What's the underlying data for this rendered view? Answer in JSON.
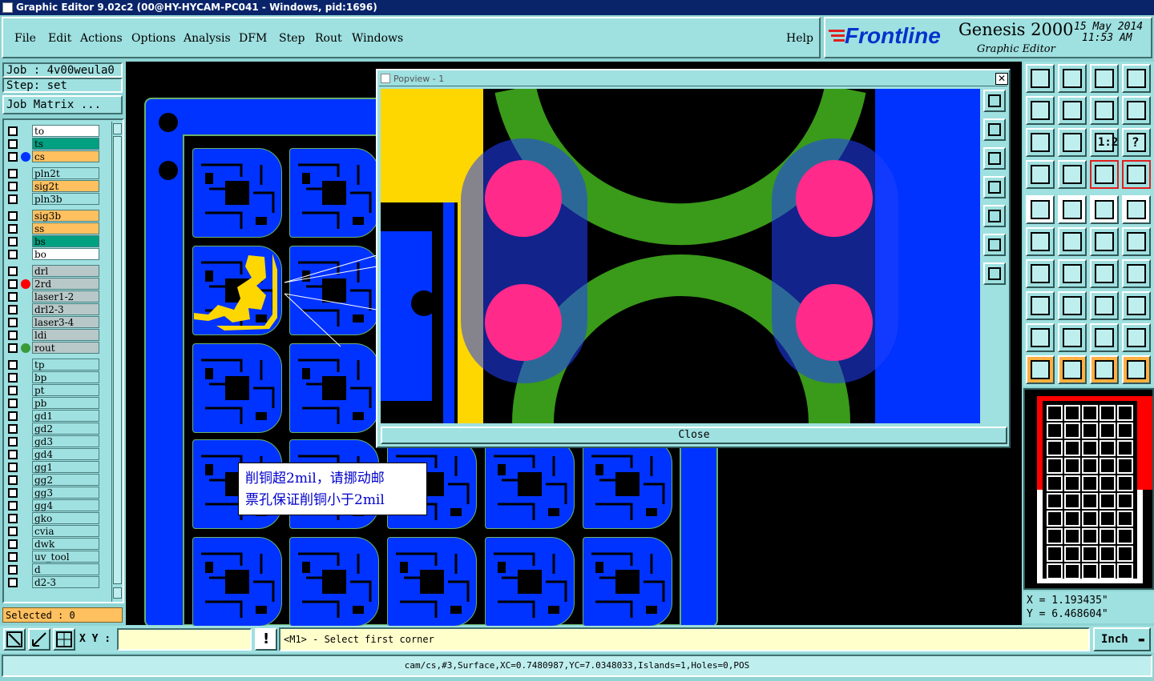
{
  "window": {
    "title": "Graphic Editor 9.02c2 (00@HY-HYCAM-PC041 - Windows, pid:1696)"
  },
  "menu": {
    "items": [
      "File",
      "Edit",
      "Actions",
      "Options",
      "Analysis",
      "DFM",
      "Step",
      "Rout",
      "Windows"
    ],
    "help": "Help"
  },
  "brand": {
    "logo": "Frontline",
    "product": "Genesis 2000",
    "subtitle": "Graphic Editor",
    "date": "15 May 2014",
    "time": "11:53 AM"
  },
  "job": {
    "job_line": "Job : 4v00weula0",
    "step_line": "Step: set",
    "matrix_button": "Job Matrix ..."
  },
  "layers": [
    {
      "name": "to",
      "bg": "#ffffff",
      "dot": ""
    },
    {
      "name": "ts",
      "bg": "#00a080",
      "dot": ""
    },
    {
      "name": "cs",
      "bg": "#ffc060",
      "dot": "#0033ff"
    },
    {
      "name": "pln2t",
      "bg": "#9fe0e0",
      "dot": ""
    },
    {
      "name": "sig2t",
      "bg": "#ffc060",
      "dot": ""
    },
    {
      "name": "pln3b",
      "bg": "#9fe0e0",
      "dot": ""
    },
    {
      "name": "sig3b",
      "bg": "#ffc060",
      "dot": ""
    },
    {
      "name": "ss",
      "bg": "#ffc060",
      "dot": ""
    },
    {
      "name": "bs",
      "bg": "#00a080",
      "dot": ""
    },
    {
      "name": "bo",
      "bg": "#ffffff",
      "dot": ""
    },
    {
      "name": "drl",
      "bg": "#b8c8c8",
      "dot": ""
    },
    {
      "name": "2rd",
      "bg": "#b8c8c8",
      "dot": "#ff0000"
    },
    {
      "name": "laser1-2",
      "bg": "#b8c8c8",
      "dot": ""
    },
    {
      "name": "drl2-3",
      "bg": "#b8c8c8",
      "dot": ""
    },
    {
      "name": "laser3-4",
      "bg": "#b8c8c8",
      "dot": ""
    },
    {
      "name": "ldi",
      "bg": "#b8c8c8",
      "dot": ""
    },
    {
      "name": "rout",
      "bg": "#b8c8c8",
      "dot": "#3a9a3a"
    },
    {
      "name": "tp",
      "bg": "#9fe0e0",
      "dot": ""
    },
    {
      "name": "bp",
      "bg": "#9fe0e0",
      "dot": ""
    },
    {
      "name": "pt",
      "bg": "#9fe0e0",
      "dot": ""
    },
    {
      "name": "pb",
      "bg": "#9fe0e0",
      "dot": ""
    },
    {
      "name": "gd1",
      "bg": "#9fe0e0",
      "dot": ""
    },
    {
      "name": "gd2",
      "bg": "#9fe0e0",
      "dot": ""
    },
    {
      "name": "gd3",
      "bg": "#9fe0e0",
      "dot": ""
    },
    {
      "name": "gd4",
      "bg": "#9fe0e0",
      "dot": ""
    },
    {
      "name": "gg1",
      "bg": "#9fe0e0",
      "dot": ""
    },
    {
      "name": "gg2",
      "bg": "#9fe0e0",
      "dot": ""
    },
    {
      "name": "gg3",
      "bg": "#9fe0e0",
      "dot": ""
    },
    {
      "name": "gg4",
      "bg": "#9fe0e0",
      "dot": ""
    },
    {
      "name": "gko",
      "bg": "#9fe0e0",
      "dot": ""
    },
    {
      "name": "cvia",
      "bg": "#9fe0e0",
      "dot": ""
    },
    {
      "name": "dwk",
      "bg": "#9fe0e0",
      "dot": ""
    },
    {
      "name": "uv_tool",
      "bg": "#9fe0e0",
      "dot": ""
    },
    {
      "name": "d",
      "bg": "#9fe0e0",
      "dot": ""
    },
    {
      "name": "d2-3",
      "bg": "#9fe0e0",
      "dot": ""
    }
  ],
  "selected": "Selected : 0",
  "popview": {
    "title": "Popview - 1",
    "close": "Close"
  },
  "annotation": {
    "line1": "削铜超2mil，请挪动邮",
    "line2": "票孔保证削铜小于2mil"
  },
  "toolbar": {
    "one_to_two": "1:2",
    "question": "?"
  },
  "coords": {
    "x": "X =  1.193435\"",
    "y": "Y =  6.468604\""
  },
  "bottom": {
    "xy_label": "X Y :",
    "xy_value": "",
    "prompt": "<M1> - Select first corner",
    "units": "Inch"
  },
  "status": "cam/cs,#3,Surface,XC=0.7480987,YC=7.0348033,Islands=1,Holes=0,POS",
  "colors": {
    "workspace": "#000000",
    "copper": "#0033ff",
    "panel": "#9fe0e0",
    "title": "#0a246a",
    "highlight": "#ffd700",
    "pad": "#ff2a8a",
    "ring": "#3a9a1a"
  }
}
